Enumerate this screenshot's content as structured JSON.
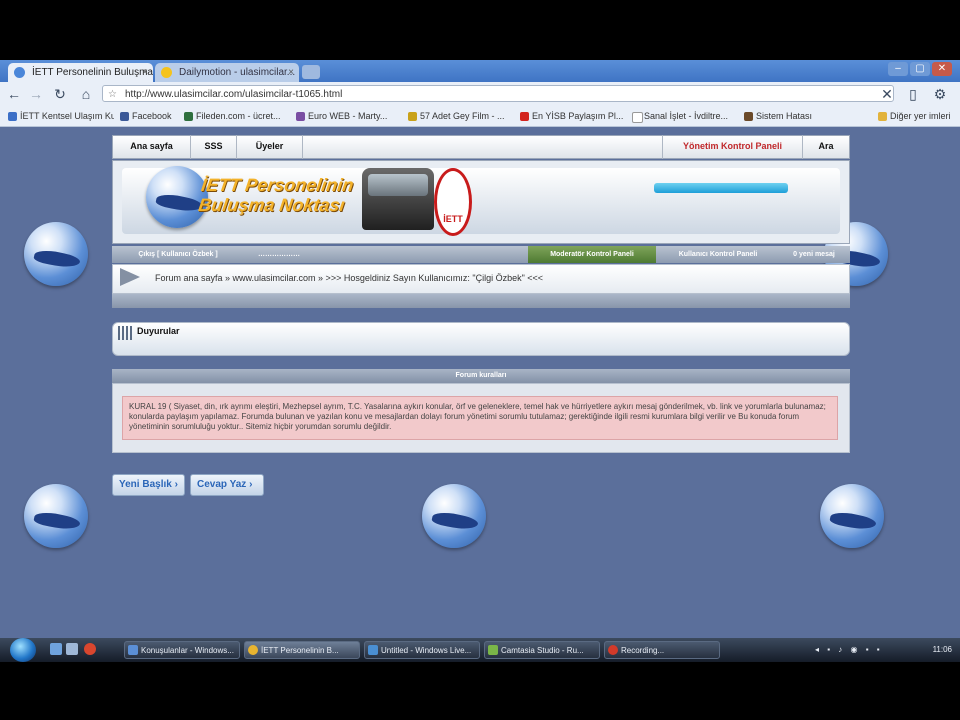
{
  "browser": {
    "tabs": [
      {
        "title": "İETT Personelinin Buluşma...",
        "active": true
      },
      {
        "title": "Dailymotion - ulasimcilar...",
        "active": false
      }
    ],
    "window_buttons": [
      "–",
      "▢",
      "✕"
    ],
    "url": "http://www.ulasimcilar.com/ulasimcilar-t1065.html",
    "bookmarks": [
      "İETT Kentsel Ulaşım Ku...",
      "Facebook",
      "Fileden.com - ücret...",
      "Euro WEB - Marty...",
      "57 Adet Gey Film - ...",
      "En YİSB Paylaşım Pl...",
      "Sanal İşlet - İvdiltre...",
      "Sistem Hatası"
    ],
    "other_bookmarks": "Diğer yer imleri"
  },
  "site": {
    "nav": {
      "home": "Ana sayfa",
      "sss": "SSS",
      "members": "Üyeler",
      "admin": "Yönetim Kontrol Paneli",
      "search": "Ara"
    },
    "logo_text": "İETT Personelinin Buluşma Noktası",
    "iett_badge": "İETT",
    "subnav": {
      "logout": "Çıkış [ Kullanıcı Özbek ]",
      "item2": "………………",
      "moderator": "Moderatör Kontrol Paneli",
      "user_panel": "Kullanıcı Kontrol Paneli",
      "messages": "0 yeni mesaj"
    },
    "breadcrumb": "Forum ana sayfa » www.ulasimcilar.com » >>> Hosgeldiniz Sayın Kullanıcımız: \"Çilgi Özbek\" <<<",
    "announcements_title": "Duyurular",
    "rules_title": "Forum kuralları",
    "rules_text": "KURAL 19 ( Siyaset, din, ırk ayrımı eleştiri, Mezhepsel ayrım, T.C. Yasalarına aykırı konular, örf ve geleneklere, temel hak ve hürriyetlere aykırı mesaj gönderilmek, vb. link ve yorumlarla bulunamaz; konularda paylaşım yapılamaz. Forumda bulunan ve yazılan konu ve mesajlardan dolayı forum yönetimi sorumlu tutulamaz; gerektiğinde ilgili resmi kurumlara bilgi verilir ve Bu konuda forum yönetiminin sorumluluğu yoktur.. Sitemiz hiçbir yorumdan sorumlu değildir.",
    "buttons": {
      "new_topic": "Yeni Başlık",
      "reply": "Cevap Yaz"
    }
  },
  "taskbar": {
    "tasks": [
      "Konuşulanlar - Windows...",
      "İETT Personelinin B...",
      "Untitled - Windows Live...",
      "Camtasia Studio - Ru...",
      "Recording..."
    ],
    "clock": "11:06"
  },
  "colors": {
    "page_bg": "#5b6f9b",
    "tab_bar": "#3f74c4",
    "admin_link": "#c0282b",
    "rules_box": "#f2c9cb",
    "button_text": "#2b66b8"
  }
}
